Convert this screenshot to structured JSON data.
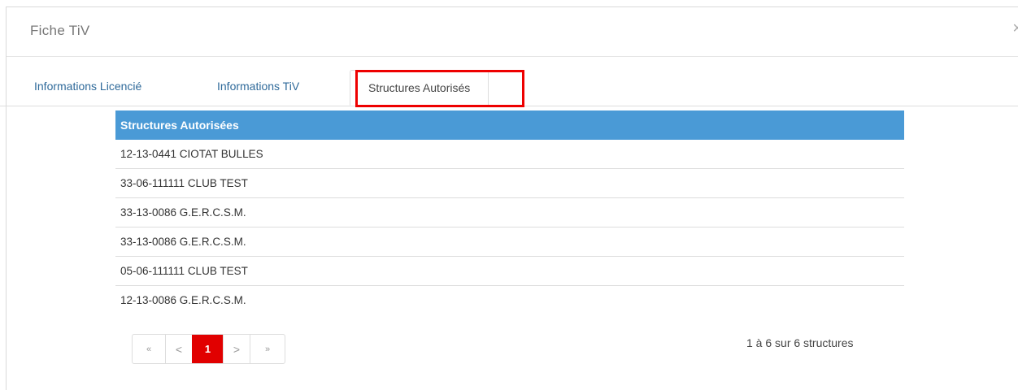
{
  "modal": {
    "title": "Fiche TiV",
    "close_icon": "×"
  },
  "tabs": [
    {
      "label": "Informations Licencié"
    },
    {
      "label": "Informations TiV"
    },
    {
      "label": "Structures Autorisés",
      "active": true
    }
  ],
  "table": {
    "header": "Structures Autorisées",
    "header_color": "#4a9ad6",
    "rows": [
      "12-13-0441 CIOTAT BULLES",
      "33-06-111111 CLUB TEST",
      "33-13-0086 G.E.R.C.S.M.",
      "33-13-0086 G.E.R.C.S.M.",
      "05-06-111111 CLUB TEST",
      "12-13-0086 G.E.R.C.S.M."
    ]
  },
  "pagination": {
    "first": "«",
    "prev": "<",
    "current": "1",
    "next": ">",
    "last": "»",
    "active_color": "#e10000"
  },
  "summary": "1 à 6 sur 6 structures",
  "highlight_color": "#ee0000"
}
